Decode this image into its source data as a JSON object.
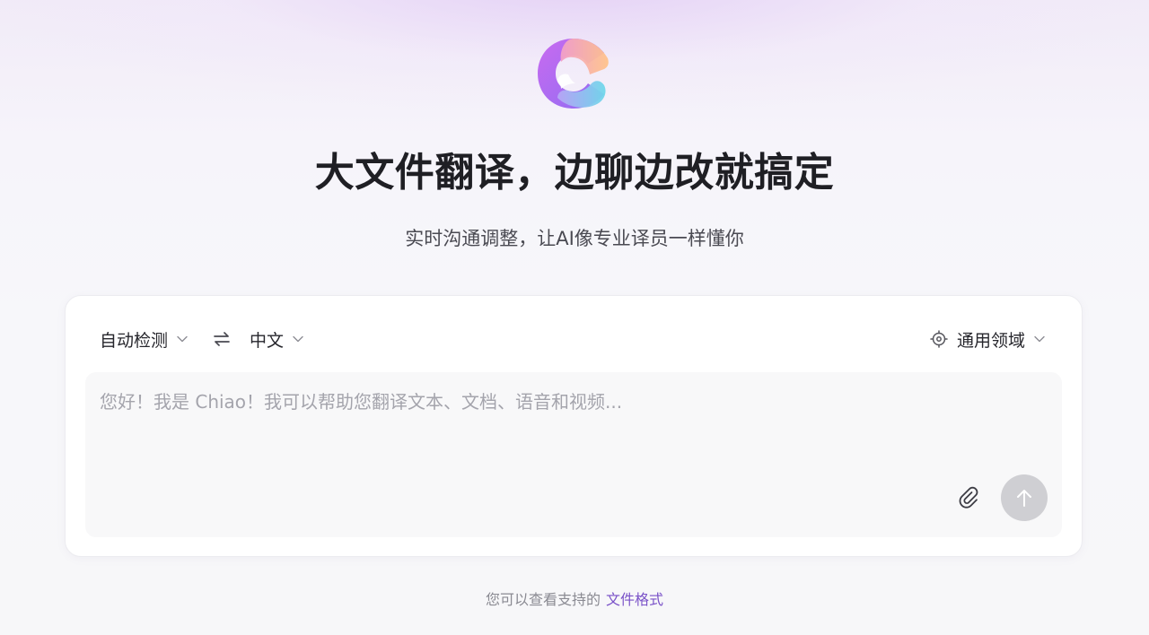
{
  "logo": {
    "icon": "chiao-logo-icon"
  },
  "hero": {
    "title": "大文件翻译，边聊边改就搞定",
    "subtitle": "实时沟通调整，让AI像专业译员一样懂你"
  },
  "translator": {
    "source_lang": "自动检测",
    "target_lang": "中文",
    "swap_icon": "swap-arrows-icon",
    "domain": "通用领域",
    "domain_icon": "target-icon",
    "input": {
      "value": "",
      "placeholder": "您好！我是 Chiao！我可以帮助您翻译文本、文档、语音和视频..."
    },
    "attach_icon": "paperclip-icon",
    "send_icon": "arrow-up-icon"
  },
  "footer": {
    "note": "您可以查看支持的",
    "link": "文件格式"
  },
  "colors": {
    "accent": "#7a52c8",
    "send_disabled": "#cfcfd3",
    "card_bg": "#ffffff",
    "input_bg": "#f8f8f9"
  }
}
